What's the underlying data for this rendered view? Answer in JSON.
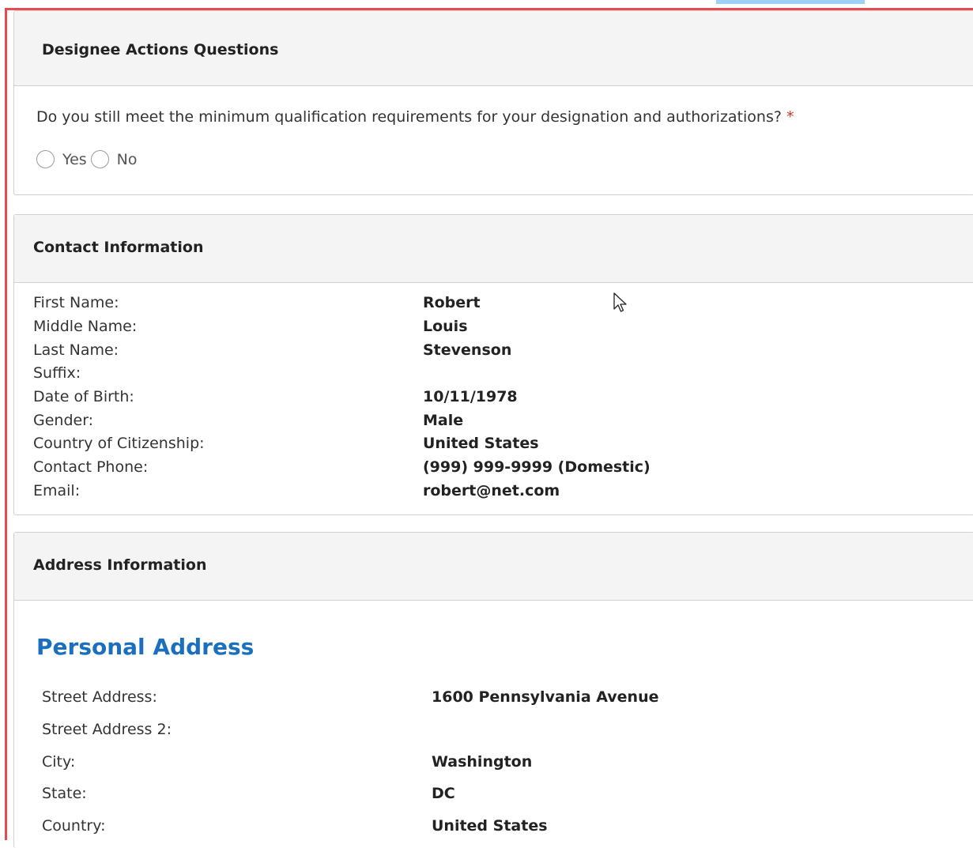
{
  "designee": {
    "heading": "Designee Actions Questions",
    "question": "Do you still meet the minimum qualification requirements for your designation and authorizations?",
    "required_mark": "*",
    "options": [
      "Yes",
      "No"
    ]
  },
  "contact": {
    "heading": "Contact Information",
    "rows": [
      {
        "label": "First Name:",
        "value": "Robert"
      },
      {
        "label": "Middle Name:",
        "value": "Louis"
      },
      {
        "label": "Last Name:",
        "value": "Stevenson"
      },
      {
        "label": "Suffix:",
        "value": ""
      },
      {
        "label": "Date of Birth:",
        "value": "10/11/1978"
      },
      {
        "label": "Gender:",
        "value": "Male"
      },
      {
        "label": "Country of Citizenship:",
        "value": "United States"
      },
      {
        "label": "Contact Phone:",
        "value": "(999) 999-9999 (Domestic)"
      },
      {
        "label": "Email:",
        "value": "robert@net.com"
      }
    ]
  },
  "address": {
    "heading": "Address Information",
    "section_title": "Personal Address",
    "rows": [
      {
        "label": "Street Address:",
        "value": "1600 Pennsylvania Avenue"
      },
      {
        "label": "Street Address 2:",
        "value": ""
      },
      {
        "label": "City:",
        "value": "Washington"
      },
      {
        "label": "State:",
        "value": "DC"
      },
      {
        "label": "Country:",
        "value": "United States"
      }
    ]
  },
  "colors": {
    "frame_border": "#e84a50",
    "section_title": "#1b6fbf",
    "top_accent": "#9fd0f5"
  },
  "icons": [
    "mouse-cursor-icon"
  ]
}
